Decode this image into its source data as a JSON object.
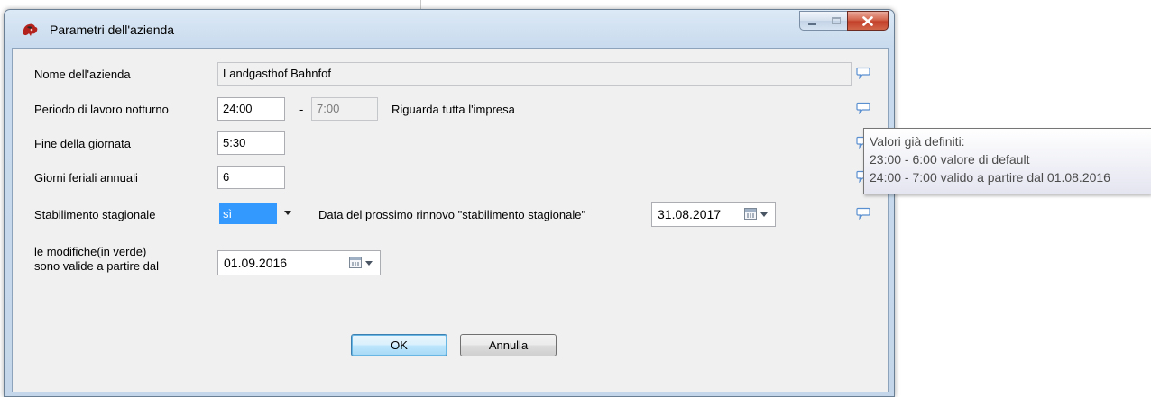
{
  "window": {
    "title": "Parametri dell'azienda"
  },
  "form": {
    "company_name": {
      "label": "Nome dell'azienda",
      "value": "Landgasthof Bahnfof"
    },
    "night_period": {
      "label": "Periodo di lavoro notturno",
      "from": "24:00",
      "separator": "-",
      "to": "7:00",
      "scope_text": "Riguarda tutta l'impresa"
    },
    "end_of_day": {
      "label": "Fine della giornata",
      "value": "5:30"
    },
    "annual_weekdays": {
      "label": "Giorni feriali annuali",
      "value": "6"
    },
    "seasonal": {
      "label": "Stabilimento stagionale",
      "selected": "sì",
      "renewal_label": "Data del prossimo rinnovo \"stabilimento stagionale\"",
      "renewal_date": "31.08.2017"
    },
    "valid_from": {
      "label_line1": "le modifiche(in verde)",
      "label_line2": "sono valide a partire dal",
      "date": "01.09.2016"
    }
  },
  "buttons": {
    "ok": "OK",
    "cancel": "Annulla"
  },
  "tooltip": {
    "line1": "Valori già definiti:",
    "line2": "23:00 - 6:00 valore di default",
    "line3": "24:00 - 7:00 valido a partire dal 01.08.2016"
  },
  "icons": {
    "app": "lion-emblem-icon",
    "note": "speech-bubble-icon",
    "calendar": "calendar-icon"
  },
  "colors": {
    "selection": "#3399ff",
    "note_icon": "#5a8fd0",
    "close_button": "#c3402a"
  }
}
